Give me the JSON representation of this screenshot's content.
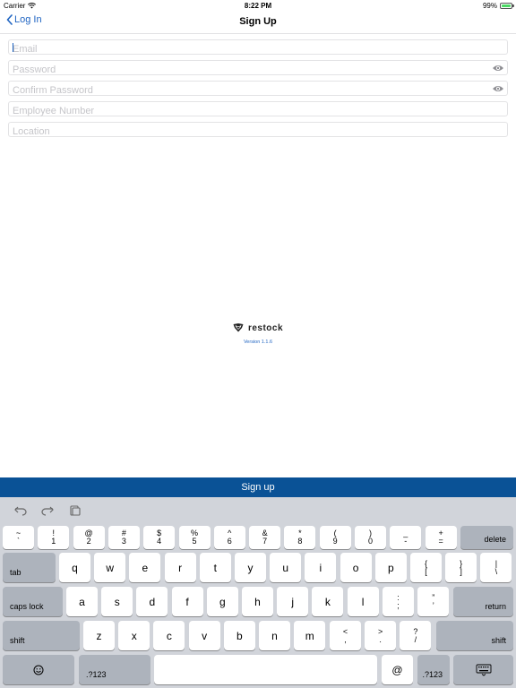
{
  "status_bar": {
    "carrier": "Carrier",
    "time": "8:22 PM",
    "battery": "99%"
  },
  "nav": {
    "back_label": "Log In",
    "title": "Sign Up"
  },
  "form": {
    "email_placeholder": "Email",
    "password_placeholder": "Password",
    "confirm_password_placeholder": "Confirm Password",
    "employee_number_placeholder": "Employee Number",
    "location_placeholder": "Location"
  },
  "branding": {
    "logo_text": "restock",
    "version": "Version 1.1.6"
  },
  "signup_button_label": "Sign up",
  "keyboard": {
    "row1": [
      {
        "top": "~",
        "bottom": "`"
      },
      {
        "top": "!",
        "bottom": "1"
      },
      {
        "top": "@",
        "bottom": "2"
      },
      {
        "top": "#",
        "bottom": "3"
      },
      {
        "top": "$",
        "bottom": "4"
      },
      {
        "top": "%",
        "bottom": "5"
      },
      {
        "top": "^",
        "bottom": "6"
      },
      {
        "top": "&",
        "bottom": "7"
      },
      {
        "top": "*",
        "bottom": "8"
      },
      {
        "top": "(",
        "bottom": "9"
      },
      {
        "top": ")",
        "bottom": "0"
      },
      {
        "top": "_",
        "bottom": "-"
      },
      {
        "top": "+",
        "bottom": "="
      }
    ],
    "delete_label": "delete",
    "tab_label": "tab",
    "row2": [
      "q",
      "w",
      "e",
      "r",
      "t",
      "y",
      "u",
      "i",
      "o",
      "p"
    ],
    "row2_extra": [
      {
        "top": "{",
        "bottom": "["
      },
      {
        "top": "}",
        "bottom": "]"
      },
      {
        "top": "|",
        "bottom": "\\"
      }
    ],
    "caps_lock_label": "caps lock",
    "row3": [
      "a",
      "s",
      "d",
      "f",
      "g",
      "h",
      "j",
      "k",
      "l"
    ],
    "row3_extra": [
      {
        "top": ":",
        "bottom": ";"
      },
      {
        "top": "”",
        "bottom": "’"
      }
    ],
    "return_label": "return",
    "shift_label": "shift",
    "row4": [
      "z",
      "x",
      "c",
      "v",
      "b",
      "n",
      "m"
    ],
    "row4_extra": [
      {
        "top": "<",
        "bottom": ","
      },
      {
        "top": ">",
        "bottom": "."
      },
      {
        "top": "?",
        "bottom": "/"
      }
    ],
    "numbers_label": ".?123",
    "at_label": "@",
    "emoji_icon": "emoji-icon",
    "hide_keyboard_icon": "keyboard-hide-icon"
  },
  "colors": {
    "accent": "#1f64c2",
    "signup_bar": "#0a5296",
    "keyboard_bg": "#d1d4da"
  }
}
